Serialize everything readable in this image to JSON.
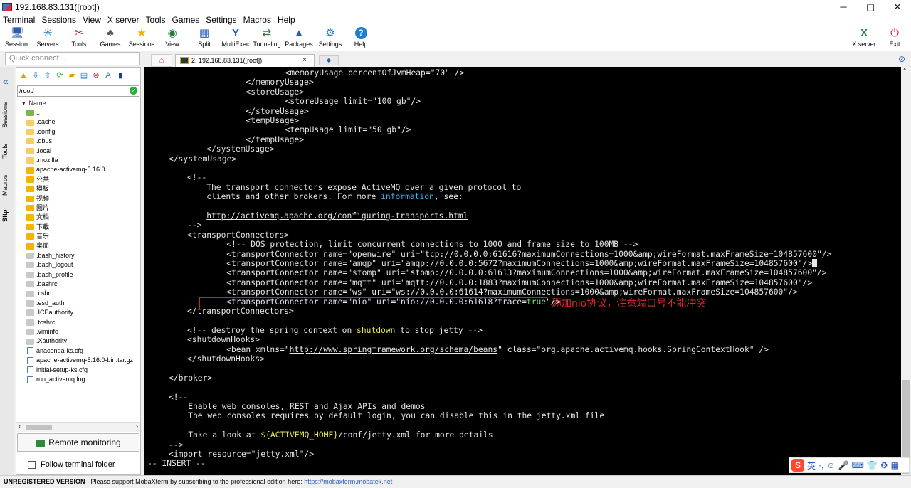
{
  "window": {
    "title": "192.168.83.131([root])",
    "controls": [
      "─",
      "▢",
      "✕"
    ]
  },
  "menu": [
    "Terminal",
    "Sessions",
    "View",
    "X server",
    "Tools",
    "Games",
    "Settings",
    "Macros",
    "Help"
  ],
  "toolbar": [
    {
      "label": "Session",
      "icon": "🖥"
    },
    {
      "label": "Servers",
      "icon": "✳"
    },
    {
      "label": "Tools",
      "icon": "✂"
    },
    {
      "label": "Games",
      "icon": "♣"
    },
    {
      "label": "Sessions",
      "icon": "★"
    },
    {
      "label": "View",
      "icon": "◉"
    },
    {
      "label": "Split",
      "icon": "▦"
    },
    {
      "label": "MultiExec",
      "icon": "Y"
    },
    {
      "label": "Tunneling",
      "icon": "⇄"
    },
    {
      "label": "Packages",
      "icon": "▲"
    },
    {
      "label": "Settings",
      "icon": "⚙"
    },
    {
      "label": "Help",
      "icon": "?"
    }
  ],
  "toolbar_right": [
    {
      "label": "X server",
      "icon": "X"
    },
    {
      "label": "Exit",
      "icon": "⏻"
    }
  ],
  "quick_connect": {
    "placeholder": "Quick connect..."
  },
  "side_tabs": [
    "Sessions",
    "Tools",
    "Macros",
    "Sftp"
  ],
  "sftp": {
    "path": "/root/",
    "column": "Name",
    "files": [
      {
        "name": "..",
        "kind": "up"
      },
      {
        "name": ".cache",
        "kind": "hidden"
      },
      {
        "name": ".config",
        "kind": "hidden"
      },
      {
        "name": ".dbus",
        "kind": "hidden"
      },
      {
        "name": ".local",
        "kind": "hidden"
      },
      {
        "name": ".mozilla",
        "kind": "hidden"
      },
      {
        "name": "apache-activemq-5.16.0",
        "kind": "folder"
      },
      {
        "name": "公共",
        "kind": "folder"
      },
      {
        "name": "模板",
        "kind": "folder"
      },
      {
        "name": "视频",
        "kind": "folder"
      },
      {
        "name": "图片",
        "kind": "folder"
      },
      {
        "name": "文档",
        "kind": "folder"
      },
      {
        "name": "下载",
        "kind": "folder"
      },
      {
        "name": "音乐",
        "kind": "folder"
      },
      {
        "name": "桌面",
        "kind": "folder"
      },
      {
        "name": ".bash_history",
        "kind": "file"
      },
      {
        "name": ".bash_logout",
        "kind": "file"
      },
      {
        "name": ".bash_profile",
        "kind": "file"
      },
      {
        "name": ".bashrc",
        "kind": "file"
      },
      {
        "name": ".cshrc",
        "kind": "file"
      },
      {
        "name": ".esd_auth",
        "kind": "file"
      },
      {
        "name": ".ICEauthority",
        "kind": "file"
      },
      {
        "name": ".tcshrc",
        "kind": "file"
      },
      {
        "name": ".viminfo",
        "kind": "file"
      },
      {
        "name": ".Xauthority",
        "kind": "file"
      },
      {
        "name": "anaconda-ks.cfg",
        "kind": "doc"
      },
      {
        "name": "apache-activemq-5.16.0-bin.tar.gz",
        "kind": "doc"
      },
      {
        "name": "initial-setup-ks.cfg",
        "kind": "doc"
      },
      {
        "name": "run_activemq.log",
        "kind": "doc"
      }
    ],
    "remote_monitoring": "Remote monitoring",
    "follow_folder": "Follow terminal folder"
  },
  "tabs": {
    "session_tab": "2. 192.168.83.131([root])"
  },
  "terminal": {
    "lines": [
      [
        {
          "t": "            <memoryUsage percentOfJvmHeap=\"70\" />"
        }
      ],
      [
        {
          "t": "        </memoryUsage>"
        }
      ],
      [
        {
          "t": "        <storeUsage>"
        }
      ],
      [
        {
          "t": "            <storeUsage limit=\"100 gb\"/>"
        }
      ],
      [
        {
          "t": "        </storeUsage>"
        }
      ],
      [
        {
          "t": "        <tempUsage>"
        }
      ],
      [
        {
          "t": "            <tempUsage limit=\"50 gb\"/>"
        }
      ],
      [
        {
          "t": "        </tempUsage>"
        }
      ],
      [
        {
          "t": "    </systemUsage>"
        }
      ],
      [
        {
          "t": "</systemUsage>"
        }
      ],
      [
        {
          "t": ""
        }
      ],
      [
        {
          "t": "<!--"
        }
      ],
      [
        {
          "t": "    The transport connectors expose ActiveMQ over a given protocol to"
        }
      ],
      [
        {
          "t": "    clients and other brokers. For more "
        },
        {
          "t": "information",
          "c": "cyan"
        },
        {
          "t": ", see:"
        }
      ],
      [
        {
          "t": ""
        }
      ],
      [
        {
          "t": "    "
        },
        {
          "t": "http://activemq.apache.org/configuring-transports.html",
          "c": "url"
        }
      ],
      [
        {
          "t": "-->"
        }
      ],
      [
        {
          "t": "<transportConnectors>"
        }
      ],
      [
        {
          "t": "    <!-- DOS protection, limit concurrent connections to 1000 and frame size to 100MB -->"
        }
      ],
      [
        {
          "t": "    <transportConnector name=\"openwire\" uri=\"tcp://0.0.0.0:61616?maximumConnections=1000&amp;wireFormat.maxFrameSize=104857600\"/>"
        }
      ],
      [
        {
          "t": "    <transportConnector name=\"amqp\" uri=\"amqp://0.0.0.0:5672?maximumConnections=1000&amp;wireFormat.maxFrameSize=104857600\"/>"
        },
        {
          "t": "",
          "c": "cursor"
        }
      ],
      [
        {
          "t": "    <transportConnector name=\"stomp\" uri=\"stomp://0.0.0.0:61613?maximumConnections=1000&amp;wireFormat.maxFrameSize=104857600\"/>"
        }
      ],
      [
        {
          "t": "    <transportConnector name=\"mqtt\" uri=\"mqtt://0.0.0.0:1883?maximumConnections=1000&amp;wireFormat.maxFrameSize=104857600\"/>"
        }
      ],
      [
        {
          "t": "    <transportConnector name=\"ws\" uri=\"ws://0.0.0.0:61614?maximumConnections=1000&amp;wireFormat.maxFrameSize=104857600\"/>"
        }
      ],
      [
        {
          "t": "    <transportConnector name=\"nio\" uri=\"nio://0.0.0.0:61618?trace="
        },
        {
          "t": "true",
          "c": "green"
        },
        {
          "t": "\"/>"
        }
      ],
      [
        {
          "t": "</transportConnectors>"
        }
      ],
      [
        {
          "t": ""
        }
      ],
      [
        {
          "t": "<!-- destroy the spring context on "
        },
        {
          "t": "shutdown",
          "c": "yellow"
        },
        {
          "t": " to stop jetty -->"
        }
      ],
      [
        {
          "t": "<shutdownHooks>"
        }
      ],
      [
        {
          "t": "    <bean xmlns=\""
        },
        {
          "t": "http://www.springframework.org/schema/beans",
          "c": "url"
        },
        {
          "t": "\" class=\"org.apache.activemq.hooks.SpringContextHook\" />"
        }
      ],
      [
        {
          "t": "</shutdownHooks>"
        }
      ],
      [
        {
          "t": ""
        }
      ],
      [
        {
          "t": "</broker>"
        }
      ],
      [
        {
          "t": ""
        }
      ],
      [
        {
          "t": "<!--"
        }
      ],
      [
        {
          "t": "    Enable web consoles, REST and Ajax APIs and demos"
        }
      ],
      [
        {
          "t": "    The web consoles requires by default login, you can disable this in the jetty.xml file"
        }
      ],
      [
        {
          "t": ""
        }
      ],
      [
        {
          "t": "    Take a look at "
        },
        {
          "t": "${ACTIVEMQ_HOME}",
          "c": "yellow"
        },
        {
          "t": "/conf/jetty.xml for more details"
        }
      ],
      [
        {
          "t": "-->"
        }
      ],
      [
        {
          "t": "<import resource=\"jetty.xml\"/>"
        }
      ],
      [
        {
          "t": "-- INSERT --"
        }
      ]
    ],
    "indents": [
      112,
      84,
      84,
      112,
      84,
      84,
      112,
      84,
      56,
      30,
      0,
      56,
      56,
      56,
      0,
      56,
      56,
      56,
      84,
      84,
      84,
      84,
      84,
      84,
      84,
      56,
      0,
      56,
      56,
      84,
      56,
      0,
      30,
      0,
      30,
      30,
      30,
      0,
      30,
      30,
      30,
      0
    ],
    "annotation": "添加nio协议，注意端口号不能冲突"
  },
  "ime": [
    "S",
    "英",
    "·,",
    "☺",
    "🎤",
    "⌨",
    "👕",
    "⚙",
    "▦"
  ],
  "status": {
    "prefix": "UNREGISTERED VERSION",
    "message": " -  Please support MobaXterm by subscribing to the professional edition here:  ",
    "link": "https://mobaxterm.mobatek.net"
  }
}
